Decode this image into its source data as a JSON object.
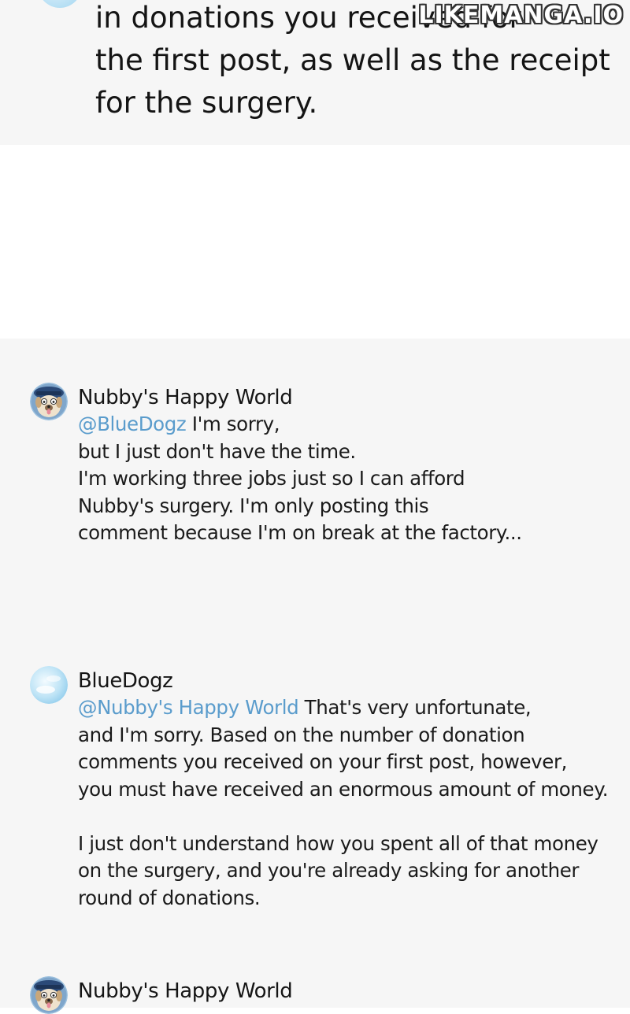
{
  "top_panel": {
    "lines": [
      "in donations you received for",
      "the first post, as well as the receipt",
      "for the surgery."
    ]
  },
  "watermark": "LIKEMANGA.IO",
  "comments": [
    {
      "author": "Nubby's Happy World",
      "avatar": "dog-avatar-icon",
      "mention": "@BlueDogz",
      "first_line_rest": " I'm sorry,",
      "lines": [
        "but I just don't have the time.",
        "I'm working three jobs just so I can afford",
        "Nubby's surgery. I'm only posting this",
        "comment because I'm on break at the factory..."
      ]
    },
    {
      "author": "BlueDogz",
      "avatar": "sky-avatar-icon",
      "mention": "@Nubby's Happy World",
      "first_line_rest": " That's very unfortunate,",
      "lines": [
        "and I'm sorry. Based on the number of donation",
        "comments you received on your first post, however,",
        "you must have received an enormous amount of money."
      ],
      "paragraph2": [
        "I just don't understand how you spent all of that money",
        "on the surgery, and you're already asking for another",
        "round of donations."
      ]
    },
    {
      "author": "Nubby's Happy World",
      "avatar": "dog-avatar-icon"
    }
  ],
  "colors": {
    "panel_bg": "#f6f6f6",
    "mention": "#5a9ccc",
    "text": "#111111"
  }
}
